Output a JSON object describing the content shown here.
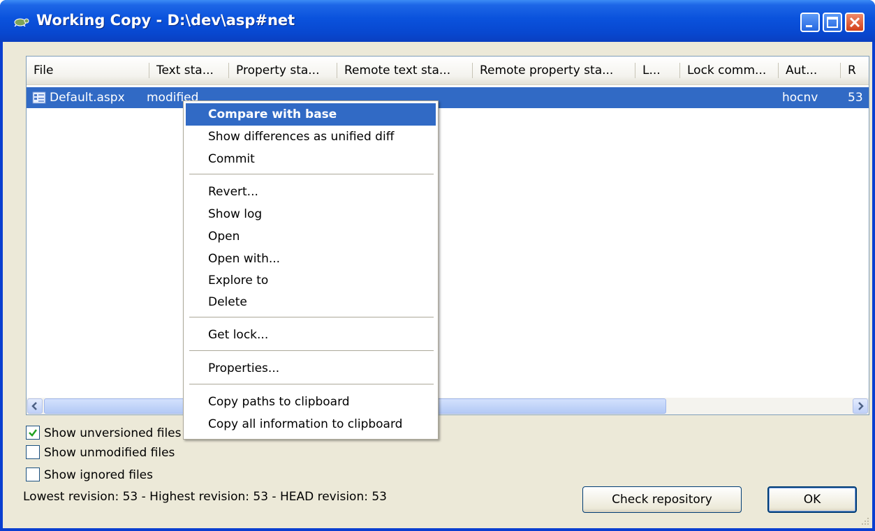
{
  "window": {
    "title": "Working Copy - D:\\dev\\asp#net",
    "controls": [
      "minimize-icon",
      "maximize-icon",
      "close-icon"
    ]
  },
  "list": {
    "columns": [
      {
        "label": "File"
      },
      {
        "label": "Text sta..."
      },
      {
        "label": "Property sta..."
      },
      {
        "label": "Remote text sta..."
      },
      {
        "label": "Remote property sta..."
      },
      {
        "label": "L..."
      },
      {
        "label": "Lock comm..."
      },
      {
        "label": "Aut..."
      },
      {
        "label": "R"
      }
    ],
    "rows": [
      {
        "file": "Default.aspx",
        "text_status": "modified",
        "author": "hocnv",
        "revision": "53",
        "selected": true
      }
    ]
  },
  "context_menu": {
    "items": [
      {
        "label": "Compare with base",
        "highlighted": true
      },
      {
        "label": "Show differences as unified diff"
      },
      {
        "label": "Commit"
      },
      {
        "label": "Revert..."
      },
      {
        "label": "Show log"
      },
      {
        "label": "Open"
      },
      {
        "label": "Open with..."
      },
      {
        "label": "Explore to"
      },
      {
        "label": "Delete"
      },
      {
        "label": "Get lock..."
      },
      {
        "label": "Properties..."
      },
      {
        "label": "Copy paths to clipboard"
      },
      {
        "label": "Copy all information to clipboard"
      }
    ]
  },
  "options": {
    "show_unversioned": {
      "label": "Show unversioned files",
      "checked": true
    },
    "show_unmodified": {
      "label": "Show unmodified files",
      "checked": false
    },
    "show_ignored": {
      "label": "Show ignored files",
      "checked": false
    }
  },
  "status": "Lowest revision: 53 - Highest revision: 53 - HEAD revision: 53",
  "buttons": {
    "check_repository": "Check repository",
    "ok": "OK"
  },
  "colors": {
    "titlebar": "#0a52dc",
    "selection": "#316ac5",
    "dialog_bg": "#ece9d8",
    "close_button": "#d2401a"
  }
}
